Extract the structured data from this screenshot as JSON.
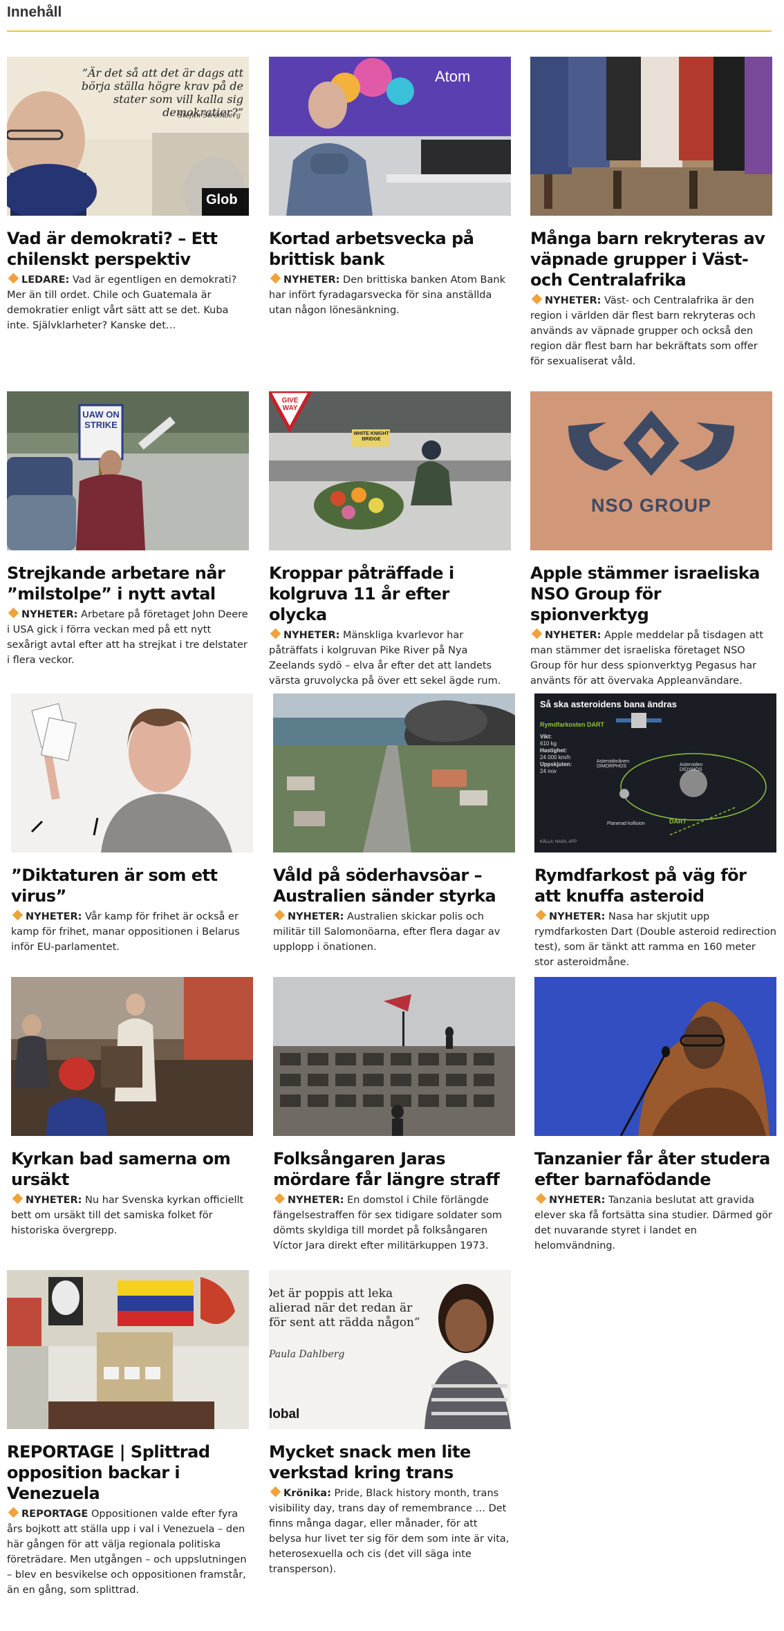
{
  "header": {
    "title": "Innehåll"
  },
  "articles": [
    {
      "title": "Vad är demokrati? – Ett chilenskt perspektiv",
      "kicker": "LEDARE:",
      "text": "Vad är egentligen en demokrati? Mer än till ordet. Chile och Guatemala är demokratier enligt vårt sätt att se det. Kuba inte. Självklarheter? Kanske det…",
      "image": {
        "quote": "”Är det så att det är dags att börja ställa högre krav på de stater som vill kalla sig demokratier?”",
        "byline": "Stefan Strömberg",
        "logo": "Glob"
      }
    },
    {
      "title": "Kortad arbetsvecka på brittisk bank",
      "kicker": "NYHETER:",
      "text": "Den brittiska banken Atom Bank har infört fyradagarsvecka för sina anställda utan någon lönesänkning.",
      "image": {
        "sign": "Atom"
      }
    },
    {
      "title": "Många barn rekryteras av väpnade grupper i Väst- och Centralafrika",
      "kicker": "NYHETER:",
      "text": "Väst- och Centralafrika är den region i världen där flest barn rekryteras och används av väpnade grupper och också den region där flest barn har bekräftats som offer för sexualiserat våld.",
      "image": {}
    },
    {
      "title": "Strejkande arbetare når ”milstolpe” i nytt avtal",
      "kicker": "NYHETER:",
      "text": "Arbetare på företaget John Deere i USA gick i förra veckan med på ett nytt sexårigt avtal efter att ha strejkat i tre delstater i flera veckor.",
      "image": {
        "sign": "UAW ON STRIKE"
      }
    },
    {
      "title": "Kroppar påträffade i kolgruva 11 år efter olycka",
      "kicker": "NYHETER:",
      "text": "Mänskliga kvarlevor har påträffats i kolgruvan Pike River på Nya Zeelands sydö – elva år efter det att landets värsta gruvolycka på över ett sekel ägde rum.",
      "image": {
        "sign": "GIVE WAY",
        "sign2": "WHITE KNIGHT BRIDGE"
      }
    },
    {
      "title": "Apple stämmer israeliska NSO Group för spionverktyg",
      "kicker": "NYHETER:",
      "text": "Apple meddelar på tisdagen att man stämmer det israeliska företaget NSO Group för hur dess spionverktyg Pegasus har använts för att övervaka Appleanvändare.",
      "image": {
        "sign": "NSO GROUP"
      }
    },
    {
      "title": "”Diktaturen är som ett virus”",
      "kicker": "NYHETER:",
      "text": "Vår kamp för frihet är också er kamp för frihet, manar oppositionen i Belarus inför EU-parlamentet.",
      "image": {}
    },
    {
      "title": "Våld på söderhavsöar – Australien sänder styrka",
      "kicker": "NYHETER:",
      "text": "Australien skickar polis och militär till Salomonöarna, efter flera dagar av upplopp i önationen.",
      "image": {}
    },
    {
      "title": "Rymdfarkost på väg för att knuffa asteroid",
      "kicker": "NYHETER:",
      "text": "Nasa har skjutit upp rymdfarkosten Dart (Double asteroid redirection test), som är tänkt att ramma en 160 meter stor asteroidmåne.",
      "image": {
        "heading": "Så ska asteroidens bana ändras",
        "label1": "Rymdfarkosten DART",
        "label2": "Vikt:",
        "value2": "610 kg",
        "label3": "Hastighet:",
        "value3": "24 000 km/h",
        "label4": "Uppskjuten:",
        "value4": "24 nov",
        "moon": "Asteroidmånen DIMORPHOS",
        "asteroid": "Asteroiden DIDYMOS",
        "dart": "DART",
        "collision": "Planerad kollision",
        "source": "KÄLLA: NASA, AFP"
      }
    },
    {
      "title": "Kyrkan bad samerna om ursäkt",
      "kicker": "NYHETER:",
      "text": "Nu har Svenska kyrkan officiellt bett om ursäkt till det samiska folket för historiska övergrepp.",
      "image": {}
    },
    {
      "title": "Folksångaren Jaras mördare får längre straff",
      "kicker": "NYHETER:",
      "text": "En domstol i Chile förlängde fängelsestraffen för sex tidigare soldater som dömts skyldiga till mordet på folksångaren Víctor Jara direkt efter militärkuppen 1973.",
      "image": {}
    },
    {
      "title": "Tanzanier får åter studera efter barnafödande",
      "kicker": "NYHETER:",
      "text": "Tanzania beslutat att gravida elever ska få fortsätta sina studier. Därmed gör det nuvarande styret i landet en helomvändning.",
      "image": {}
    },
    {
      "title": "REPORTAGE | Splittrad opposition backar i Venezuela",
      "kicker": "REPORTAGE",
      "text": "Oppositionen valde efter fyra års bojkott att ställa upp i val i Venezuela – den här gången för att välja regionala politiska företrädare. Men utgången – och uppslutningen – blev en besvikelse och oppositionen framstår, än en gång, som splittrad.",
      "image": {}
    },
    {
      "title": "Mycket snack men lite verkstad kring trans",
      "kicker": "Krönika:",
      "text": "Pride, Black history month, trans visibility day, trans day of remembrance … Det finns många dagar, eller månader, för att belysa hur livet ter sig för dem som inte är vita, heterosexuella och cis (det vill säga inte transperson).",
      "image": {
        "quote": "Det är poppis att leka alierad när det redan är för sent att rädda någon”",
        "byline": "Paula Dahlberg",
        "logo": "lobal"
      }
    }
  ]
}
